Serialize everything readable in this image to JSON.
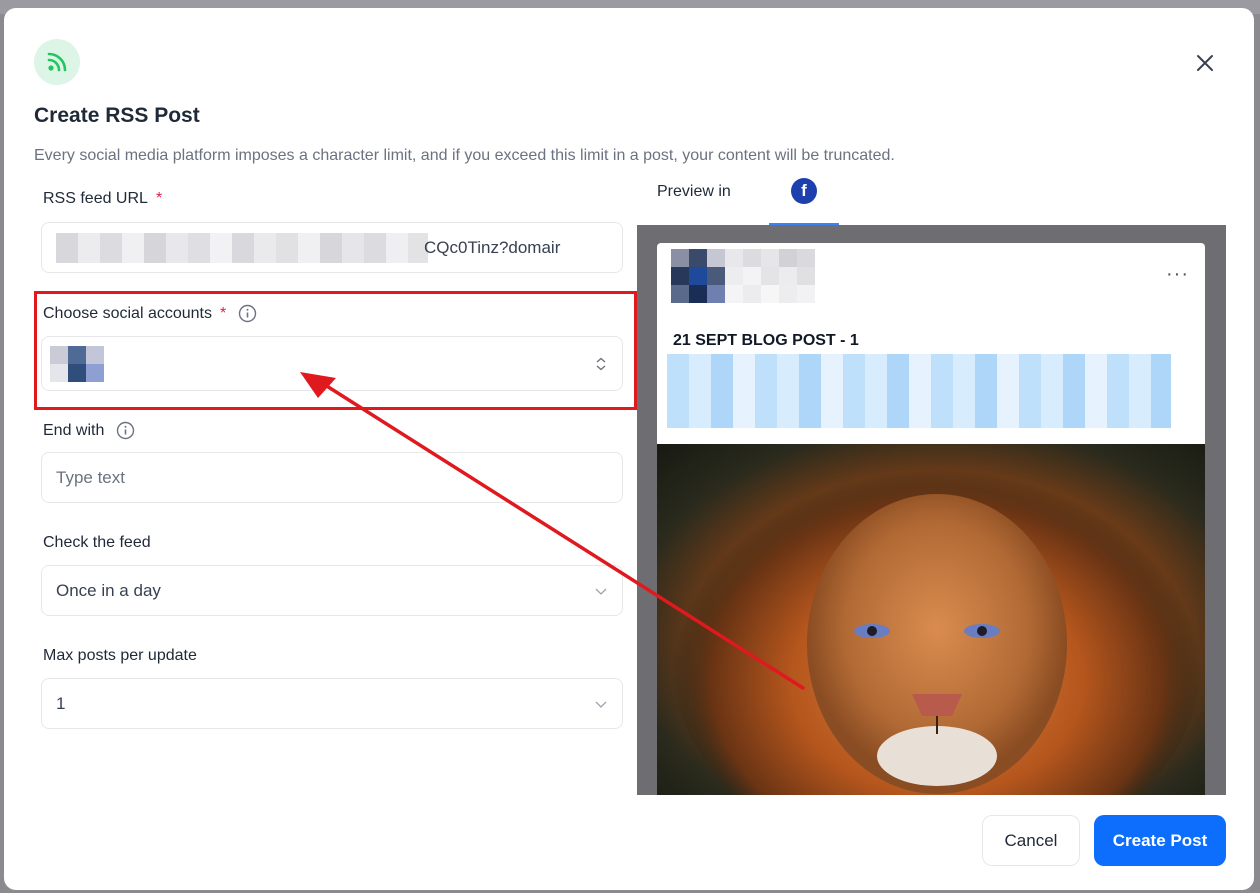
{
  "modal": {
    "title": "Create RSS Post",
    "subtitle": "Every social media platform imposes a character limit, and if you exceed this limit in a post, your content will be truncated.",
    "header_icon": "rss-icon",
    "close_icon": "close-icon"
  },
  "form": {
    "rss_url": {
      "label": "RSS feed URL",
      "required_mark": "*",
      "visible_value": "CQc0Tinz?domair"
    },
    "social_accounts": {
      "label": "Choose social accounts",
      "required_mark": "*",
      "info_icon": "info-icon"
    },
    "end_with": {
      "label": "End with",
      "placeholder": "Type text",
      "info_icon": "info-icon"
    },
    "check_feed": {
      "label": "Check the feed",
      "selected": "Once in a day"
    },
    "max_posts": {
      "label": "Max posts per update",
      "selected": "1"
    }
  },
  "preview": {
    "label": "Preview in",
    "platform_icon": "facebook-icon",
    "platform_glyph": "f",
    "post_title": "21 SEPT BLOG POST - 1",
    "menu_glyph": "···"
  },
  "footer": {
    "cancel_label": "Cancel",
    "create_label": "Create Post"
  },
  "colors": {
    "accent": "#0d6efd",
    "highlight": "#e0191f",
    "required": "#e11d48",
    "facebook": "#1e40af",
    "tab_underline": "#3b82f6"
  }
}
